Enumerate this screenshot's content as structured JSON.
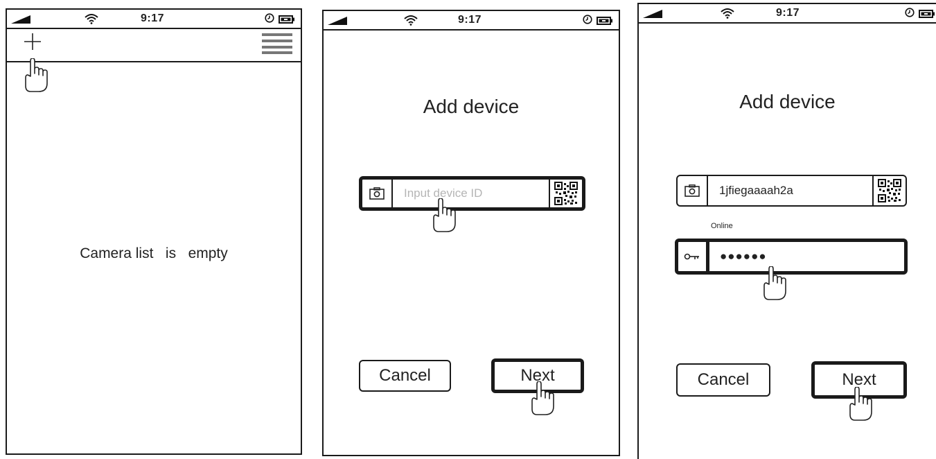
{
  "status_bar": {
    "time": "9:17"
  },
  "screen1": {
    "empty_message": "Camera list   is   empty"
  },
  "screen2": {
    "title": "Add device",
    "device_id_placeholder": "Input device ID",
    "cancel_label": "Cancel",
    "next_label": "Next"
  },
  "screen3": {
    "title": "Add device",
    "device_id_value": "1jfiegaaaah2a",
    "status_label": "Online",
    "password_value": "●●●●●●",
    "cancel_label": "Cancel",
    "next_label": "Next"
  },
  "icons": [
    "signal-icon",
    "wifi-icon",
    "clock-icon",
    "battery-icon",
    "add-icon",
    "menu-icon",
    "camera-icon",
    "qr-code-icon",
    "key-icon",
    "tap-hand-icon"
  ]
}
